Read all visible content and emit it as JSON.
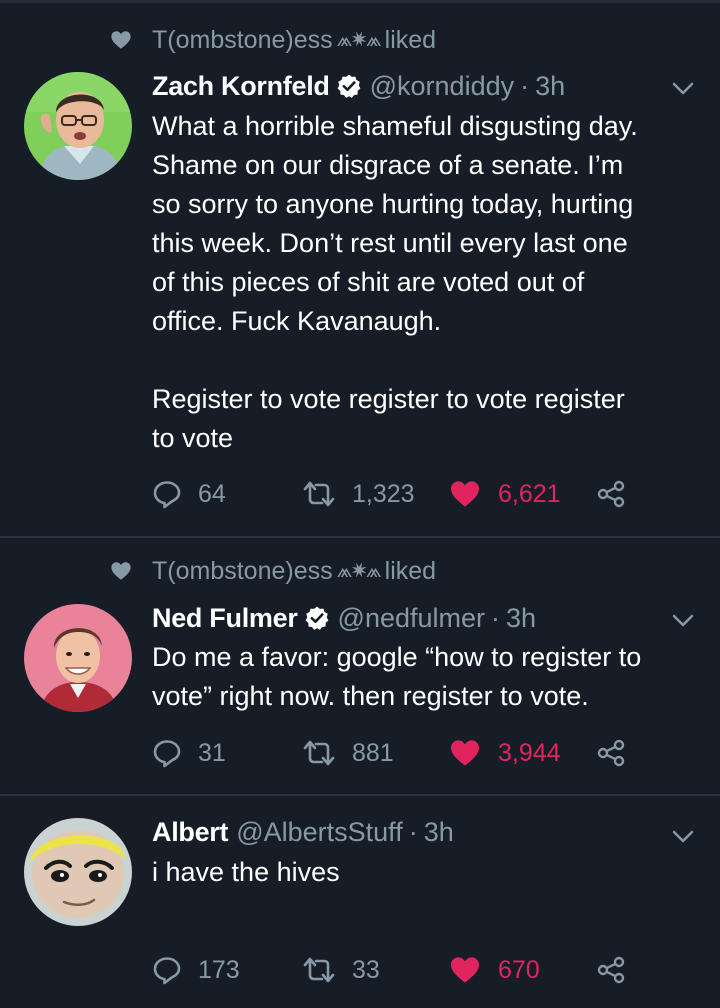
{
  "tweets": [
    {
      "social_context": {
        "prefix": "T(ombstone)ess",
        "decoration": "⩕✷⩕",
        "suffix": "liked"
      },
      "author": {
        "display_name": "Zach Kornfeld",
        "handle": "@korndiddy",
        "separator": "·",
        "time": "3h",
        "verified": true
      },
      "text": "What a horrible shameful disgusting day.\nShame on our disgrace of a senate. I’m\nso sorry to anyone hurting today, hurting\nthis week. Don’t rest until every last one\nof this pieces of shit are voted out of\noffice. Fuck Kavanaugh.\n\nRegister to vote register to vote register\nto vote",
      "replies": "64",
      "retweets": "1,323",
      "likes": "6,621",
      "liked": true
    },
    {
      "social_context": {
        "prefix": "T(ombstone)ess",
        "decoration": "⩕✷⩕",
        "suffix": "liked"
      },
      "author": {
        "display_name": "Ned Fulmer",
        "handle": "@nedfulmer",
        "separator": "·",
        "time": "3h",
        "verified": true
      },
      "text": "Do me a favor: google “how to register to\nvote” right now. then register to vote.",
      "replies": "31",
      "retweets": "881",
      "likes": "3,944",
      "liked": true
    },
    {
      "author": {
        "display_name": "Albert",
        "handle": "@AlbertsStuff",
        "separator": "·",
        "time": "3h",
        "verified": false
      },
      "text": "i have the hives",
      "replies": "173",
      "retweets": "33",
      "likes": "670",
      "liked": true
    }
  ],
  "colors": {
    "background": "#161d27",
    "divider": "#2a3440",
    "secondary_text": "#8899a6",
    "like_red": "#e0245e",
    "verified": "#ffffff"
  },
  "icons": {
    "social_context": "heart-icon",
    "verified": "verified-badge-icon",
    "menu": "chevron-down-icon",
    "reply": "reply-icon",
    "retweet": "retweet-icon",
    "like": "heart-icon",
    "share": "share-icon"
  }
}
